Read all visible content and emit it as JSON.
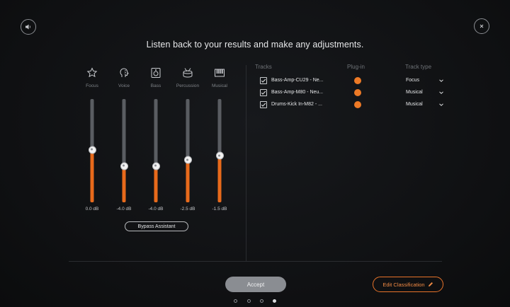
{
  "headline": "Listen back to your results and make any adjustments.",
  "top_buttons": {
    "audio_icon": "speaker-icon",
    "close_icon": "close-icon"
  },
  "channels": [
    {
      "label": "Focus",
      "value": "0.0 dB",
      "level": 0.51,
      "icon": "star-icon"
    },
    {
      "label": "Voice",
      "value": "-4.0 dB",
      "level": 0.35,
      "icon": "voice-head-icon"
    },
    {
      "label": "Bass",
      "value": "-4.0 dB",
      "level": 0.35,
      "icon": "speaker-box-icon"
    },
    {
      "label": "Percussion",
      "value": "-2.5 dB",
      "level": 0.41,
      "icon": "drum-icon"
    },
    {
      "label": "Musical",
      "value": "-1.5 dB",
      "level": 0.45,
      "icon": "keyboard-icon"
    }
  ],
  "bypass_label": "Bypass Assistant",
  "tracks_header": {
    "tracks": "Tracks",
    "plugin": "Plug-in",
    "type": "Track type"
  },
  "tracks": [
    {
      "name": "Bass-Amp-CU29 - Ne...",
      "type": "Focus",
      "checked": true
    },
    {
      "name": "Bass-Amp-M80 - Neu...",
      "type": "Musical",
      "checked": true
    },
    {
      "name": "Drums-Kick In-M82 - ...",
      "type": "Musical",
      "checked": true
    }
  ],
  "accept_label": "Accept",
  "edit_label": "Edit Classification",
  "pager": {
    "count": 4,
    "active": 3
  },
  "colors": {
    "accent": "#e86a1b",
    "plugin": "#ee7a26",
    "track": "#5a5d62"
  }
}
